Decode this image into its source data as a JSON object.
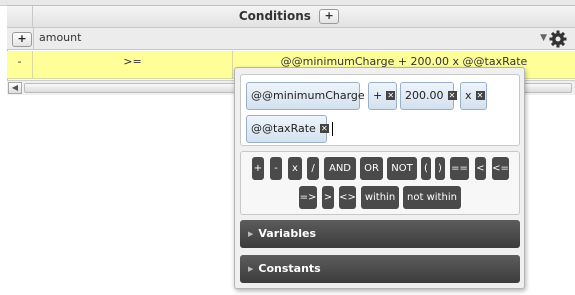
{
  "conditions": {
    "title": "Conditions",
    "add_label": "+"
  },
  "field_row": {
    "add_label": "+",
    "selected_field": "amount"
  },
  "data_row": {
    "remove_label": "-",
    "operator": ">=",
    "expression": "@@minimumCharge + 200.00 x @@taxRate"
  },
  "editor": {
    "tokens": [
      "@@minimumCharge",
      "+",
      "200.00",
      "x",
      "@@taxRate"
    ],
    "operators": [
      "+",
      "-",
      "x",
      "/",
      "AND",
      "OR",
      "NOT",
      "(",
      ")",
      "==",
      "<",
      "<=",
      "=>",
      ">",
      "<>",
      "within",
      "not within"
    ],
    "sections": [
      "Variables",
      "Constants"
    ]
  },
  "colors": {
    "row_highlight": "#ffff99",
    "operator_button": "#4a4a4a",
    "section_header": "#4b4b4b"
  },
  "icons": {
    "gear": "gear-icon",
    "token_remove": "close-icon",
    "section_expand": "triangle-right-icon"
  }
}
